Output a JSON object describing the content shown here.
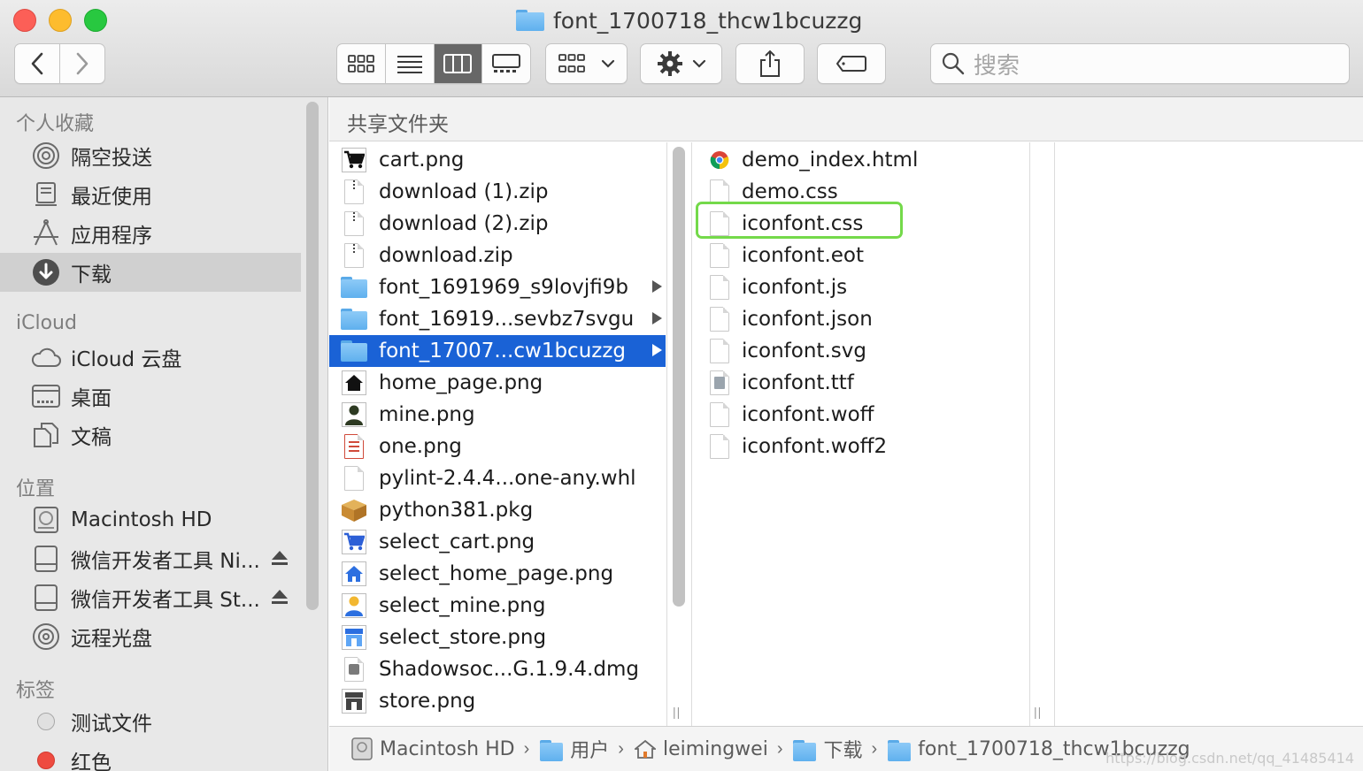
{
  "window": {
    "title": "font_1700718_thcw1bcuzzg"
  },
  "toolbar": {
    "search_placeholder": "搜索"
  },
  "sidebar": {
    "sections": [
      {
        "header": "个人收藏",
        "items": [
          {
            "label": "隔空投送",
            "icon": "airdrop-icon"
          },
          {
            "label": "最近使用",
            "icon": "recents-icon"
          },
          {
            "label": "应用程序",
            "icon": "applications-icon"
          },
          {
            "label": "下载",
            "icon": "downloads-icon",
            "selected": true
          }
        ]
      },
      {
        "header": "iCloud",
        "items": [
          {
            "label": "iCloud 云盘",
            "icon": "cloud-icon"
          },
          {
            "label": "桌面",
            "icon": "desktop-icon"
          },
          {
            "label": "文稿",
            "icon": "documents-icon"
          }
        ]
      },
      {
        "header": "位置",
        "items": [
          {
            "label": "Macintosh HD",
            "icon": "harddisk-icon"
          },
          {
            "label": "微信开发者工具 Ni...",
            "icon": "drive-icon",
            "eject": true
          },
          {
            "label": "微信开发者工具 St...",
            "icon": "drive-icon",
            "eject": true
          },
          {
            "label": "远程光盘",
            "icon": "disc-icon"
          }
        ]
      },
      {
        "header": "标签",
        "items": [
          {
            "label": "测试文件",
            "tag_color": "#e0e0e0"
          },
          {
            "label": "红色",
            "tag_color": "#ee4b40"
          }
        ]
      }
    ]
  },
  "content": {
    "header": "共享文件夹",
    "column1": [
      {
        "name": "cart.png",
        "icon": "cart-icon"
      },
      {
        "name": "download (1).zip",
        "icon": "zip-icon"
      },
      {
        "name": "download (2).zip",
        "icon": "zip-icon"
      },
      {
        "name": "download.zip",
        "icon": "zip-icon"
      },
      {
        "name": "font_1691969_s9lovjfi9b",
        "icon": "folder-icon",
        "folder": true
      },
      {
        "name": "font_16919...sevbz7svgu",
        "icon": "folder-icon",
        "folder": true
      },
      {
        "name": "font_17007...cw1bcuzzg",
        "icon": "folder-icon",
        "folder": true,
        "selected": true
      },
      {
        "name": "home_page.png",
        "icon": "home-icon"
      },
      {
        "name": "mine.png",
        "icon": "person-icon"
      },
      {
        "name": "one.png",
        "icon": "document-icon"
      },
      {
        "name": "pylint-2.4.4...one-any.whl",
        "icon": "blank-file-icon"
      },
      {
        "name": "python381.pkg",
        "icon": "package-icon"
      },
      {
        "name": "select_cart.png",
        "icon": "cart-blue-icon"
      },
      {
        "name": "select_home_page.png",
        "icon": "home-blue-icon"
      },
      {
        "name": "select_mine.png",
        "icon": "person-blue-icon"
      },
      {
        "name": "select_store.png",
        "icon": "store-blue-icon"
      },
      {
        "name": "Shadowsoc...G.1.9.4.dmg",
        "icon": "dmg-icon"
      },
      {
        "name": "store.png",
        "icon": "store-icon"
      }
    ],
    "column2": [
      {
        "name": "demo_index.html",
        "icon": "chrome-html-icon"
      },
      {
        "name": "demo.css",
        "icon": "blank-file-icon"
      },
      {
        "name": "iconfont.css",
        "icon": "blank-file-icon",
        "highlighted": true
      },
      {
        "name": "iconfont.eot",
        "icon": "blank-file-icon"
      },
      {
        "name": "iconfont.js",
        "icon": "blank-file-icon"
      },
      {
        "name": "iconfont.json",
        "icon": "blank-file-icon"
      },
      {
        "name": "iconfont.svg",
        "icon": "blank-file-icon"
      },
      {
        "name": "iconfont.ttf",
        "icon": "font-file-icon"
      },
      {
        "name": "iconfont.woff",
        "icon": "blank-file-icon"
      },
      {
        "name": "iconfont.woff2",
        "icon": "blank-file-icon"
      }
    ],
    "highlight_color": "#74d94a",
    "selection_color": "#1a62d6"
  },
  "pathbar": {
    "crumbs": [
      {
        "label": "Macintosh HD",
        "icon": "harddisk-icon"
      },
      {
        "label": "用户",
        "icon": "folder-icon"
      },
      {
        "label": "leimingwei",
        "icon": "home-icon"
      },
      {
        "label": "下载",
        "icon": "downloads-folder-icon"
      },
      {
        "label": "font_1700718_thcw1bcuzzg",
        "icon": "folder-icon"
      }
    ],
    "watermark": "https://blog.csdn.net/qq_41485414"
  }
}
